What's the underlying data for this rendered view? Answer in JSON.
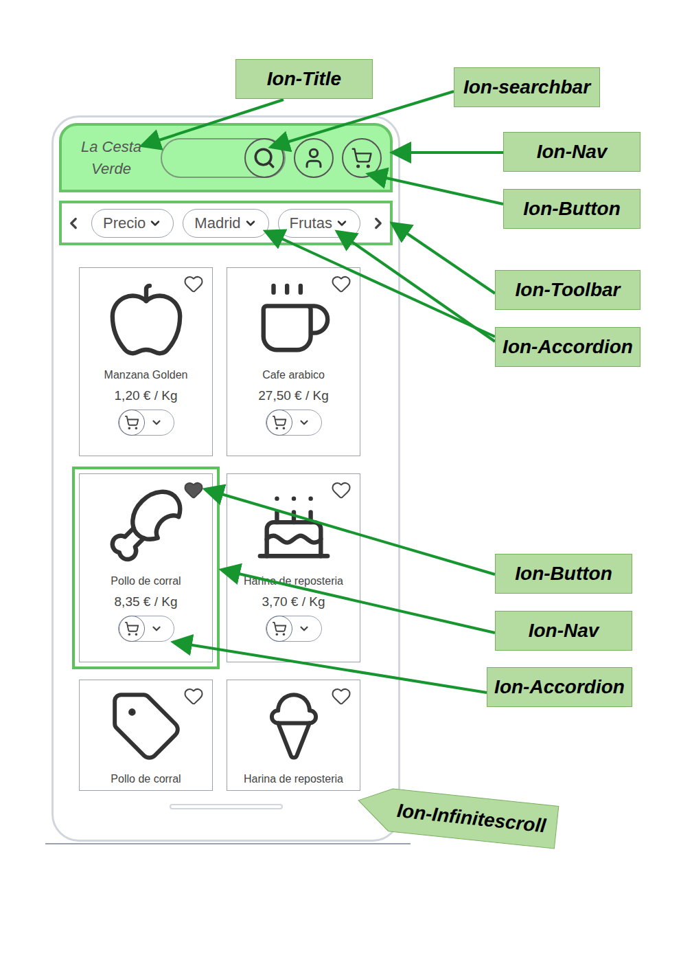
{
  "app": {
    "title_lines": [
      "La Cesta",
      "Verde"
    ]
  },
  "filters": [
    {
      "label": "Precio"
    },
    {
      "label": "Madrid"
    },
    {
      "label": "Frutas"
    }
  ],
  "products": [
    {
      "name": "Manzana Golden",
      "price": "1,20 € / Kg",
      "favorite": false,
      "highlighted": false
    },
    {
      "name": "Cafe arabico",
      "price": "27,50 € / Kg",
      "favorite": false,
      "highlighted": false
    },
    {
      "name": "Pollo de corral",
      "price": "8,35 € / Kg",
      "favorite": true,
      "highlighted": true
    },
    {
      "name": "Harina de reposteria",
      "price": "3,70 € / Kg",
      "favorite": false,
      "highlighted": false
    },
    {
      "name": "Pollo de corral",
      "favorite": false,
      "highlighted": false
    },
    {
      "name": "Harina de reposteria",
      "favorite": false,
      "highlighted": false
    }
  ],
  "annotations": [
    {
      "label": "Ion-Title"
    },
    {
      "label": "Ion-searchbar"
    },
    {
      "label": "Ion-Nav"
    },
    {
      "label": "Ion-Button"
    },
    {
      "label": "Ion-Toolbar"
    },
    {
      "label": "Ion-Accordion"
    },
    {
      "label": "Ion-Button"
    },
    {
      "label": "Ion-Nav"
    },
    {
      "label": "Ion-Accordion"
    },
    {
      "label": "Ion-Infinitescroll"
    }
  ]
}
